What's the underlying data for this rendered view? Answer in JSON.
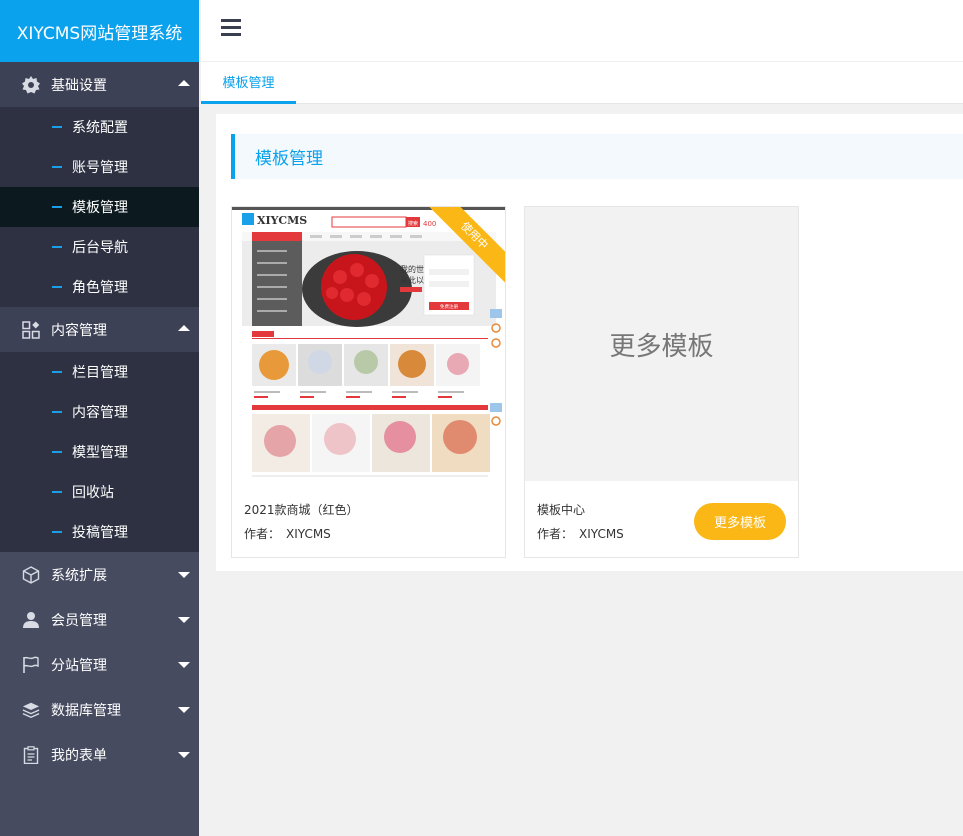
{
  "app": {
    "title": "XIYCMS网站管理系统"
  },
  "sidebar": {
    "groups": [
      {
        "label": "基础设置",
        "icon": "gear-icon",
        "expanded": true,
        "items": [
          {
            "label": "系统配置"
          },
          {
            "label": "账号管理"
          },
          {
            "label": "模板管理",
            "active": true
          },
          {
            "label": "后台导航"
          },
          {
            "label": "角色管理"
          }
        ]
      },
      {
        "label": "内容管理",
        "icon": "grid-icon",
        "expanded": true,
        "items": [
          {
            "label": "栏目管理"
          },
          {
            "label": "内容管理"
          },
          {
            "label": "模型管理"
          },
          {
            "label": "回收站"
          },
          {
            "label": "投稿管理"
          }
        ]
      },
      {
        "label": "系统扩展",
        "icon": "cube-icon",
        "expanded": false
      },
      {
        "label": "会员管理",
        "icon": "user-icon",
        "expanded": false
      },
      {
        "label": "分站管理",
        "icon": "flag-icon",
        "expanded": false
      },
      {
        "label": "数据库管理",
        "icon": "database-icon",
        "expanded": false
      },
      {
        "label": "我的表单",
        "icon": "clipboard-icon",
        "expanded": false
      }
    ]
  },
  "tabs": [
    {
      "label": "模板管理",
      "active": true
    }
  ],
  "main": {
    "section_title": "模板管理",
    "templates": [
      {
        "name": "2021款商城（红色）",
        "author_label": "作者：",
        "author": "XIYCMS",
        "badge": "使用中",
        "preview": {
          "logo": "XIYCMS",
          "search_button": "搜索",
          "phone": "400",
          "banner_text_1": "我的世",
          "banner_text_2": "从此以",
          "login_button": "免费注册"
        }
      },
      {
        "name": "模板中心",
        "author_label": "作者：",
        "author": "XIYCMS",
        "placeholder_text": "更多模板",
        "button_label": "更多模板"
      }
    ]
  },
  "colors": {
    "brand": "#0aa1ed",
    "sidebar_bg": "#464b60",
    "submenu_bg": "#2e3142",
    "active_bg": "#0c1a1f",
    "accent_yellow": "#fbb716",
    "shop_red": "#e4393c"
  }
}
